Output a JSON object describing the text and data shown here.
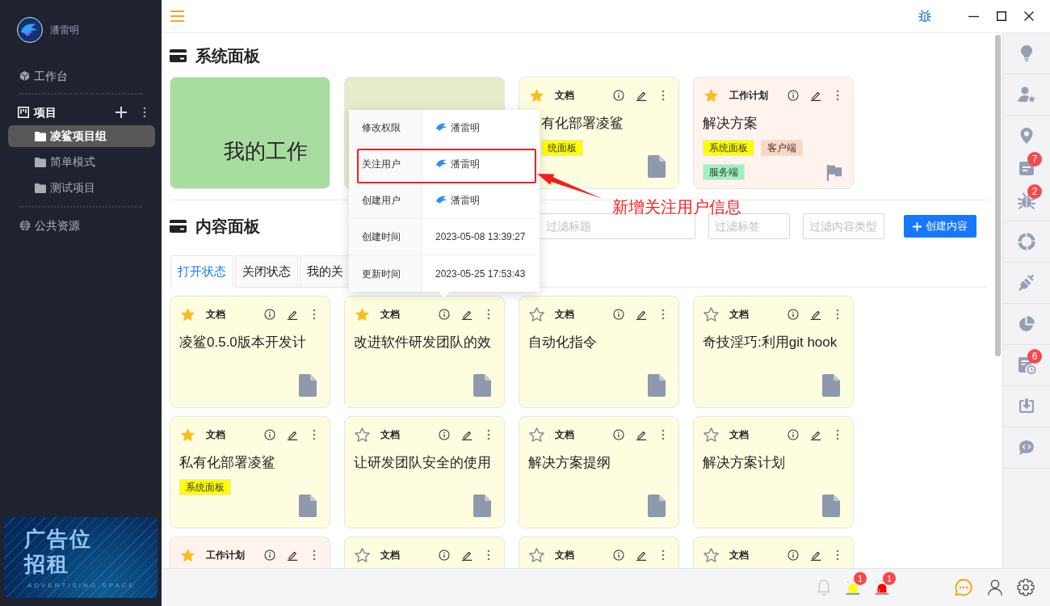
{
  "sidebar": {
    "user_name": "潘雷明",
    "workbench": "工作台",
    "projects_label": "项目",
    "projects": [
      {
        "label": "凌鲨项目组",
        "selected": true
      },
      {
        "label": "简单模式",
        "selected": false
      },
      {
        "label": "测试项目",
        "selected": false
      }
    ],
    "public_resources": "公共资源",
    "ad": {
      "title_lines": [
        "广告位",
        "招租"
      ],
      "tagline": "ADVERTISING SPACE"
    }
  },
  "system_panel": {
    "title": "系统面板",
    "cards": [
      {
        "kind": "shortcut",
        "color": "#a8dda0",
        "title": "我的工作"
      },
      {
        "kind": "shortcut",
        "color": "#e6ebc9"
      },
      {
        "kind": "document",
        "starred": true,
        "type_label": "文档",
        "title": "有化部署凌鲨",
        "tags": [
          {
            "label": "统面板",
            "color": "#ffff00"
          }
        ]
      },
      {
        "kind": "work_plan",
        "starred": true,
        "type_label": "工作计划",
        "title": "解决方案",
        "tags": [
          {
            "label": "系统面板",
            "color": "#ffff00"
          },
          {
            "label": "客户端",
            "color": "#fcd5c4"
          },
          {
            "label": "服务端",
            "color": "#9ff0c0"
          }
        ]
      }
    ]
  },
  "content_panel": {
    "title": "内容面板",
    "filters": [
      {
        "placeholder": "过滤标题"
      },
      {
        "placeholder": "过滤标签"
      },
      {
        "placeholder": "过滤内容类型"
      }
    ],
    "create_button": "创建内容",
    "tabs": [
      {
        "label": "打开状态",
        "selected": true
      },
      {
        "label": "关闭状态",
        "selected": false
      },
      {
        "label": "我的关",
        "selected": false
      }
    ],
    "cards": [
      {
        "kind": "document",
        "starred": true,
        "type_label": "文档",
        "title": "凌鲨0.5.0版本开发计"
      },
      {
        "kind": "document",
        "starred": true,
        "type_label": "文档",
        "title": "改进软件研发团队的效",
        "info_popup": {
          "rows": [
            {
              "label": "修改权限",
              "kind": "user",
              "value": "潘雷明",
              "annotated": false
            },
            {
              "label": "关注用户",
              "kind": "user",
              "value": "潘雷明",
              "annotated": true
            },
            {
              "label": "创建用户",
              "kind": "user",
              "value": "潘雷明",
              "annotated": false
            },
            {
              "label": "创建时间",
              "kind": "time",
              "value": "2023-05-08 13:39:27",
              "annotated": false
            },
            {
              "label": "更新时间",
              "kind": "time",
              "value": "2023-05-25 17:53:43",
              "annotated": false
            }
          ]
        }
      },
      {
        "kind": "document",
        "starred": false,
        "type_label": "文档",
        "title": "自动化指令"
      },
      {
        "kind": "document",
        "starred": false,
        "type_label": "文档",
        "title": "奇技淫巧:利用git hook"
      },
      {
        "kind": "document",
        "starred": true,
        "type_label": "文档",
        "title": "私有化部署凌鲨",
        "tags": [
          {
            "label": "系统面板",
            "color": "#ffff00"
          }
        ]
      },
      {
        "kind": "document",
        "starred": false,
        "type_label": "文档",
        "title": "让研发团队安全的使用"
      },
      {
        "kind": "document",
        "starred": false,
        "type_label": "文档",
        "title": "解决方案提纲"
      },
      {
        "kind": "document",
        "starred": false,
        "type_label": "文档",
        "title": "解决方案计划"
      },
      {
        "kind": "work_plan",
        "starred": true,
        "type_label": "工作计划"
      },
      {
        "kind": "document",
        "starred": false,
        "type_label": "文档"
      },
      {
        "kind": "document",
        "starred": false,
        "type_label": "文档"
      },
      {
        "kind": "document",
        "starred": false,
        "type_label": "文档"
      }
    ]
  },
  "annotation": {
    "text": "新增关注用户信息"
  },
  "right_toolbar": [
    [
      {
        "kind": "bulb"
      }
    ],
    [
      {
        "kind": "member"
      }
    ],
    [
      {
        "kind": "pin"
      },
      {
        "kind": "doc",
        "badge": "7"
      },
      {
        "kind": "bug",
        "badge": "2"
      }
    ],
    [
      {
        "kind": "ring"
      }
    ],
    [
      {
        "kind": "plug"
      }
    ],
    [
      {
        "kind": "pie"
      }
    ],
    [
      {
        "kind": "schedule",
        "badge": "6"
      }
    ],
    [
      {
        "kind": "download"
      }
    ],
    [
      {
        "kind": "code"
      }
    ]
  ],
  "status_bar": {
    "alerts": [
      {
        "kind": "bell"
      },
      {
        "kind": "alarm",
        "color": "#ffff00",
        "badge": "1"
      },
      {
        "kind": "alarm",
        "color": "#ff0000",
        "badge": "1"
      }
    ]
  }
}
